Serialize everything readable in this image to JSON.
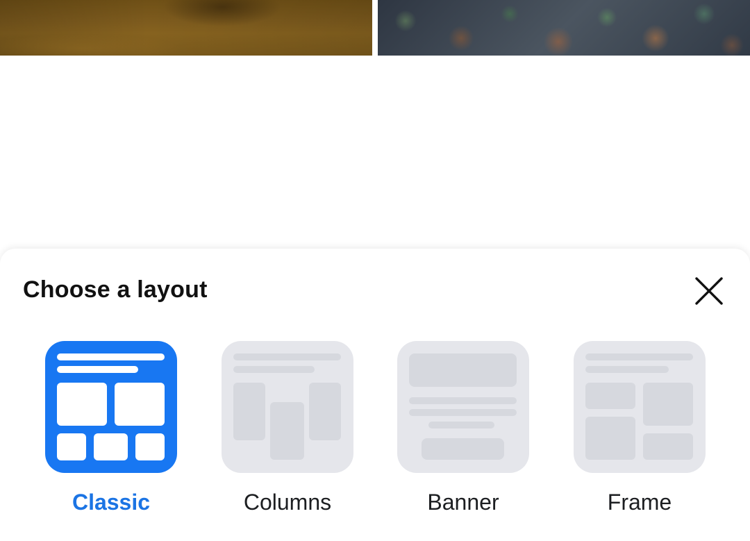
{
  "sheet": {
    "title": "Choose a layout",
    "close_icon": "close-icon"
  },
  "layouts": [
    {
      "label": "Classic",
      "icon": "classic-layout-icon",
      "selected": true
    },
    {
      "label": "Columns",
      "icon": "columns-layout-icon",
      "selected": false
    },
    {
      "label": "Banner",
      "icon": "banner-layout-icon",
      "selected": false
    },
    {
      "label": "Frame",
      "icon": "frame-layout-icon",
      "selected": false
    }
  ],
  "colors": {
    "accent": "#1877f2",
    "accent_text": "#1b74e4",
    "tile_inactive": "#e5e6eb",
    "shape_inactive": "#d6d8de",
    "text": "#1c1e21"
  }
}
